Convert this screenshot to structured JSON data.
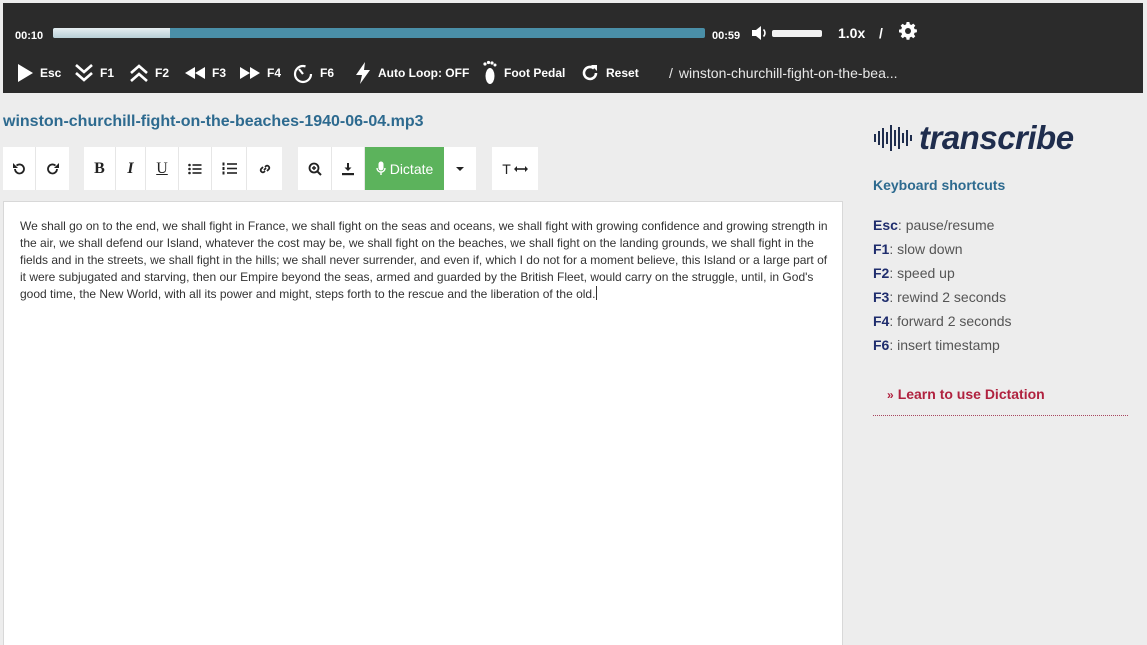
{
  "player": {
    "current_time": "00:10",
    "total_time": "00:59",
    "progress_fraction": 0.18,
    "volume_fraction": 1.0,
    "speed": "1.0x",
    "speed_separator": "/",
    "controls": [
      {
        "key": "play",
        "label": "Esc",
        "icon": "play-icon"
      },
      {
        "key": "slow",
        "label": "F1",
        "icon": "double-chevron-down-icon"
      },
      {
        "key": "fast",
        "label": "F2",
        "icon": "double-chevron-up-icon"
      },
      {
        "key": "rewind",
        "label": "F3",
        "icon": "rewind-icon"
      },
      {
        "key": "forward",
        "label": "F4",
        "icon": "fast-forward-icon"
      },
      {
        "key": "timestamp",
        "label": "F6",
        "icon": "timer-icon"
      },
      {
        "key": "autoloop",
        "label": "Auto Loop: OFF",
        "icon": "lightning-icon"
      },
      {
        "key": "pedal",
        "label": "Foot Pedal",
        "icon": "foot-icon"
      },
      {
        "key": "reset",
        "label": "Reset",
        "icon": "refresh-icon"
      }
    ],
    "breadcrumb_separator": "/",
    "breadcrumb_file": "winston-churchill-fight-on-the-bea..."
  },
  "file": {
    "name": "winston-churchill-fight-on-the-beaches-1940-06-04.mp3"
  },
  "toolbar": {
    "bold": "B",
    "italic": "I",
    "underline": "U",
    "dictate_label": "Dictate",
    "text_width_label": "T"
  },
  "editor": {
    "text": "We shall go on to the end, we shall fight in France, we shall fight on the seas and oceans, we shall fight with growing confidence and growing strength in the air, we shall defend our Island, whatever the cost may be, we shall fight on the beaches, we shall fight on the landing grounds, we shall fight in the fields and in the streets, we shall fight in the hills; we shall never surrender, and even if, which I do not for a moment believe, this Island or a large part of it were subjugated and starving, then our Empire beyond the seas, armed and guarded by the British Fleet, would carry on the struggle, until, in God's good time, the New World, with all its power and might, steps forth to the rescue and the liberation of the old."
  },
  "sidebar": {
    "logo_text": "transcribe",
    "shortcuts_title": "Keyboard shortcuts",
    "shortcuts": [
      {
        "key": "Esc",
        "desc": "pause/resume"
      },
      {
        "key": "F1",
        "desc": "slow down"
      },
      {
        "key": "F2",
        "desc": "speed up"
      },
      {
        "key": "F3",
        "desc": "rewind 2 seconds"
      },
      {
        "key": "F4",
        "desc": "forward 2 seconds"
      },
      {
        "key": "F6",
        "desc": "insert timestamp"
      }
    ],
    "learn_marker": "»",
    "learn_link": "Learn to use Dictation"
  },
  "colors": {
    "player_bg": "#2b2b2b",
    "progress_track": "#4a8fa8",
    "accent_blue": "#2d6a8f",
    "dictate_green": "#5cb35c",
    "learn_red": "#b0223f"
  }
}
